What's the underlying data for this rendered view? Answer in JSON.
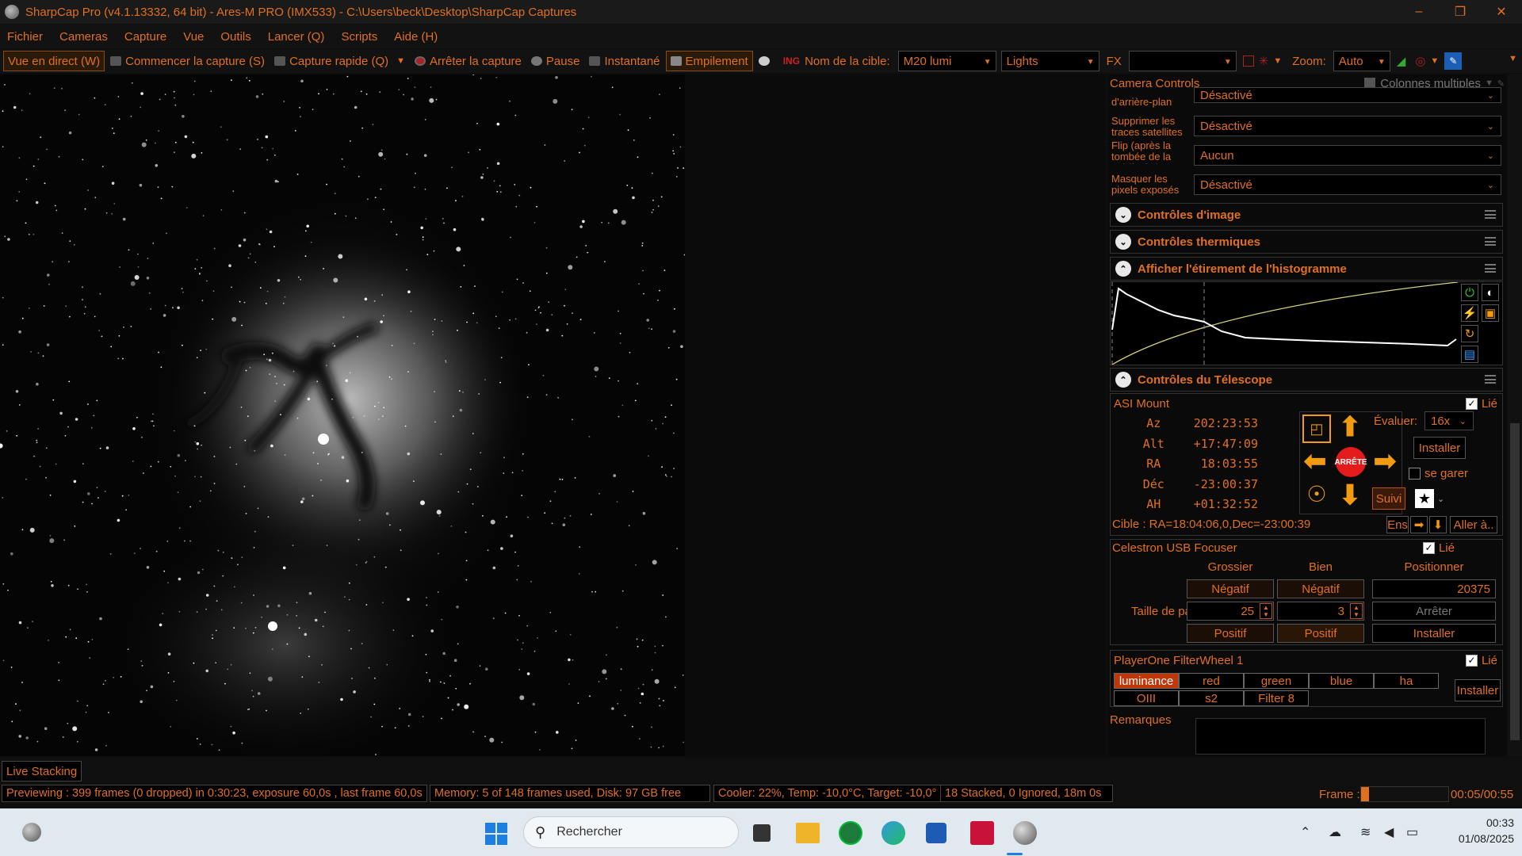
{
  "window": {
    "title": "SharpCap Pro (v4.1.13332, 64 bit) - Ares-M PRO (IMX533) - C:\\Users\\beck\\Desktop\\SharpCap Captures",
    "controls": [
      "–",
      "❐",
      "✕"
    ]
  },
  "menu": [
    "Fichier",
    "Cameras",
    "Capture",
    "Vue",
    "Outils",
    "Lancer (Q)",
    "Scripts",
    "Aide (H)"
  ],
  "toolbar": {
    "live_view": "Vue en direct (W)",
    "start_capture": "Commencer la capture (S)",
    "quick_capture": "Capture rapide (Q)",
    "stop_capture": "Arrêter la capture",
    "pause": "Pause",
    "snapshot": "Instantané",
    "stacking": "Empilement",
    "target_label": "Nom de la cible:",
    "target_value": "M20 lumi",
    "frame_type": "Lights",
    "fx_label": "FX",
    "fx_value": "",
    "zoom_label": "Zoom:",
    "zoom_value": "Auto"
  },
  "panel": {
    "title": "Camera Controls",
    "multi_columns": "Colonnes multiples",
    "rows": [
      {
        "label": "d'arrière-plan",
        "value": "Désactivé"
      },
      {
        "label": "Supprimer les traces satellites",
        "value": "Désactivé"
      },
      {
        "label": "Flip (après la tombée de la nuit/à plat)",
        "value": "Aucun"
      },
      {
        "label": "Masquer les pixels exposés",
        "value": "Désactivé"
      }
    ],
    "sections": {
      "image": "Contrôles d'image",
      "thermal": "Contrôles thermiques",
      "histogram": "Afficher l'étirement de l'histogramme",
      "telescope": "Contrôles du Télescope"
    },
    "mount": {
      "name": "ASI Mount",
      "linked": "Lié",
      "coords": [
        {
          "k": "Az",
          "v": "202:23:53"
        },
        {
          "k": "Alt",
          "v": "+17:47:09"
        },
        {
          "k": "RA",
          "v": "18:03:55"
        },
        {
          "k": "Déc",
          "v": "-23:00:37"
        },
        {
          "k": "AH",
          "v": "+01:32:52"
        }
      ],
      "stop": "ARRÊTE",
      "rate_label": "Évaluer:",
      "rate_value": "16x",
      "install": "Installer",
      "park": "se garer",
      "track": "Suivi",
      "target": "Cible : RA=18:04:06,0,Dec=-23:00:39",
      "ens": "Ens",
      "goto": "Aller à.."
    },
    "focuser": {
      "name": "Celestron USB Focuser",
      "linked": "Lié",
      "coarse": "Grossier",
      "fine": "Bien",
      "position": "Positionner",
      "negative": "Négatif",
      "positive": "Positif",
      "step_label": "Taille de pas",
      "coarse_step": "25",
      "fine_step": "3",
      "position_value": "20375",
      "stop": "Arrêter",
      "install": "Installer"
    },
    "filterwheel": {
      "name": "PlayerOne FilterWheel 1",
      "linked": "Lié",
      "filters": [
        "luminance",
        "red",
        "green",
        "blue",
        "ha",
        "OIII",
        "s2",
        "Filter 8"
      ],
      "install": "Installer"
    },
    "notes_label": "Remarques"
  },
  "status": {
    "live_stacking": "Live Stacking",
    "preview": "Previewing : 399 frames (0 dropped) in 0:30:23, exposure 60,0s , last frame 60,0s",
    "memory": "Memory: 5 of 148 frames used, Disk: 97 GB free",
    "cooler": "Cooler: 22%, Temp: -10,0°C, Target: -10,0°",
    "stacked": "18 Stacked, 0 Ignored, 18m 0s",
    "frame_label": "Frame :",
    "frame_time": "00:05/00:55",
    "frame_progress": 0.09
  },
  "taskbar": {
    "search": "Rechercher",
    "time": "00:33",
    "date": "01/08/2025"
  },
  "colors": {
    "accent": "#e07020",
    "arrow": "#f29a12",
    "stop": "#e31b1b",
    "selected_filter": "#c0380a"
  }
}
